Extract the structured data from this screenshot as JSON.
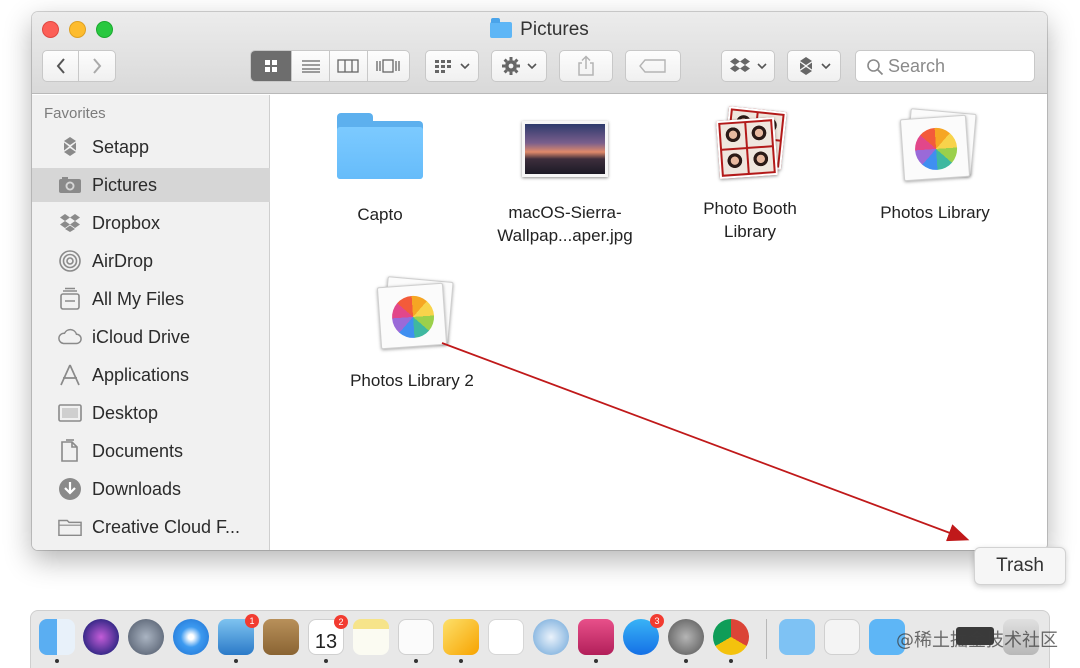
{
  "window": {
    "title": "Pictures"
  },
  "toolbar": {
    "view_modes": [
      "icon-view",
      "list-view",
      "column-view",
      "cover-flow-view"
    ],
    "selected_view": "icon-view",
    "search_placeholder": "Search"
  },
  "sidebar": {
    "heading": "Favorites",
    "items": [
      {
        "label": "Setapp",
        "icon": "setapp-icon"
      },
      {
        "label": "Pictures",
        "icon": "camera-icon",
        "selected": true
      },
      {
        "label": "Dropbox",
        "icon": "dropbox-icon"
      },
      {
        "label": "AirDrop",
        "icon": "airdrop-icon"
      },
      {
        "label": "All My Files",
        "icon": "all-files-icon"
      },
      {
        "label": "iCloud Drive",
        "icon": "cloud-icon"
      },
      {
        "label": "Applications",
        "icon": "applications-icon"
      },
      {
        "label": "Desktop",
        "icon": "desktop-icon"
      },
      {
        "label": "Documents",
        "icon": "document-icon"
      },
      {
        "label": "Downloads",
        "icon": "download-icon"
      },
      {
        "label": "Creative Cloud F...",
        "icon": "folder-icon"
      }
    ]
  },
  "files": [
    {
      "label": "Capto",
      "type": "folder"
    },
    {
      "label_line1": "macOS-Sierra-",
      "label_line2": "Wallpap...aper.jpg",
      "type": "image"
    },
    {
      "label_line1": "Photo Booth",
      "label_line2": "Library",
      "type": "photobooth-library"
    },
    {
      "label": "Photos Library",
      "type": "photos-library"
    },
    {
      "label": "Photos Library 2",
      "type": "photos-library"
    }
  ],
  "tooltip": {
    "label": "Trash"
  },
  "dock": {
    "badges": {
      "preview": "1",
      "calendar": "2",
      "appstore": "3"
    },
    "calendar_day": "13"
  },
  "colors": {
    "accent": "#c0191a",
    "folder": "#5db0ee"
  },
  "watermark": "@稀土掘金技术社区"
}
